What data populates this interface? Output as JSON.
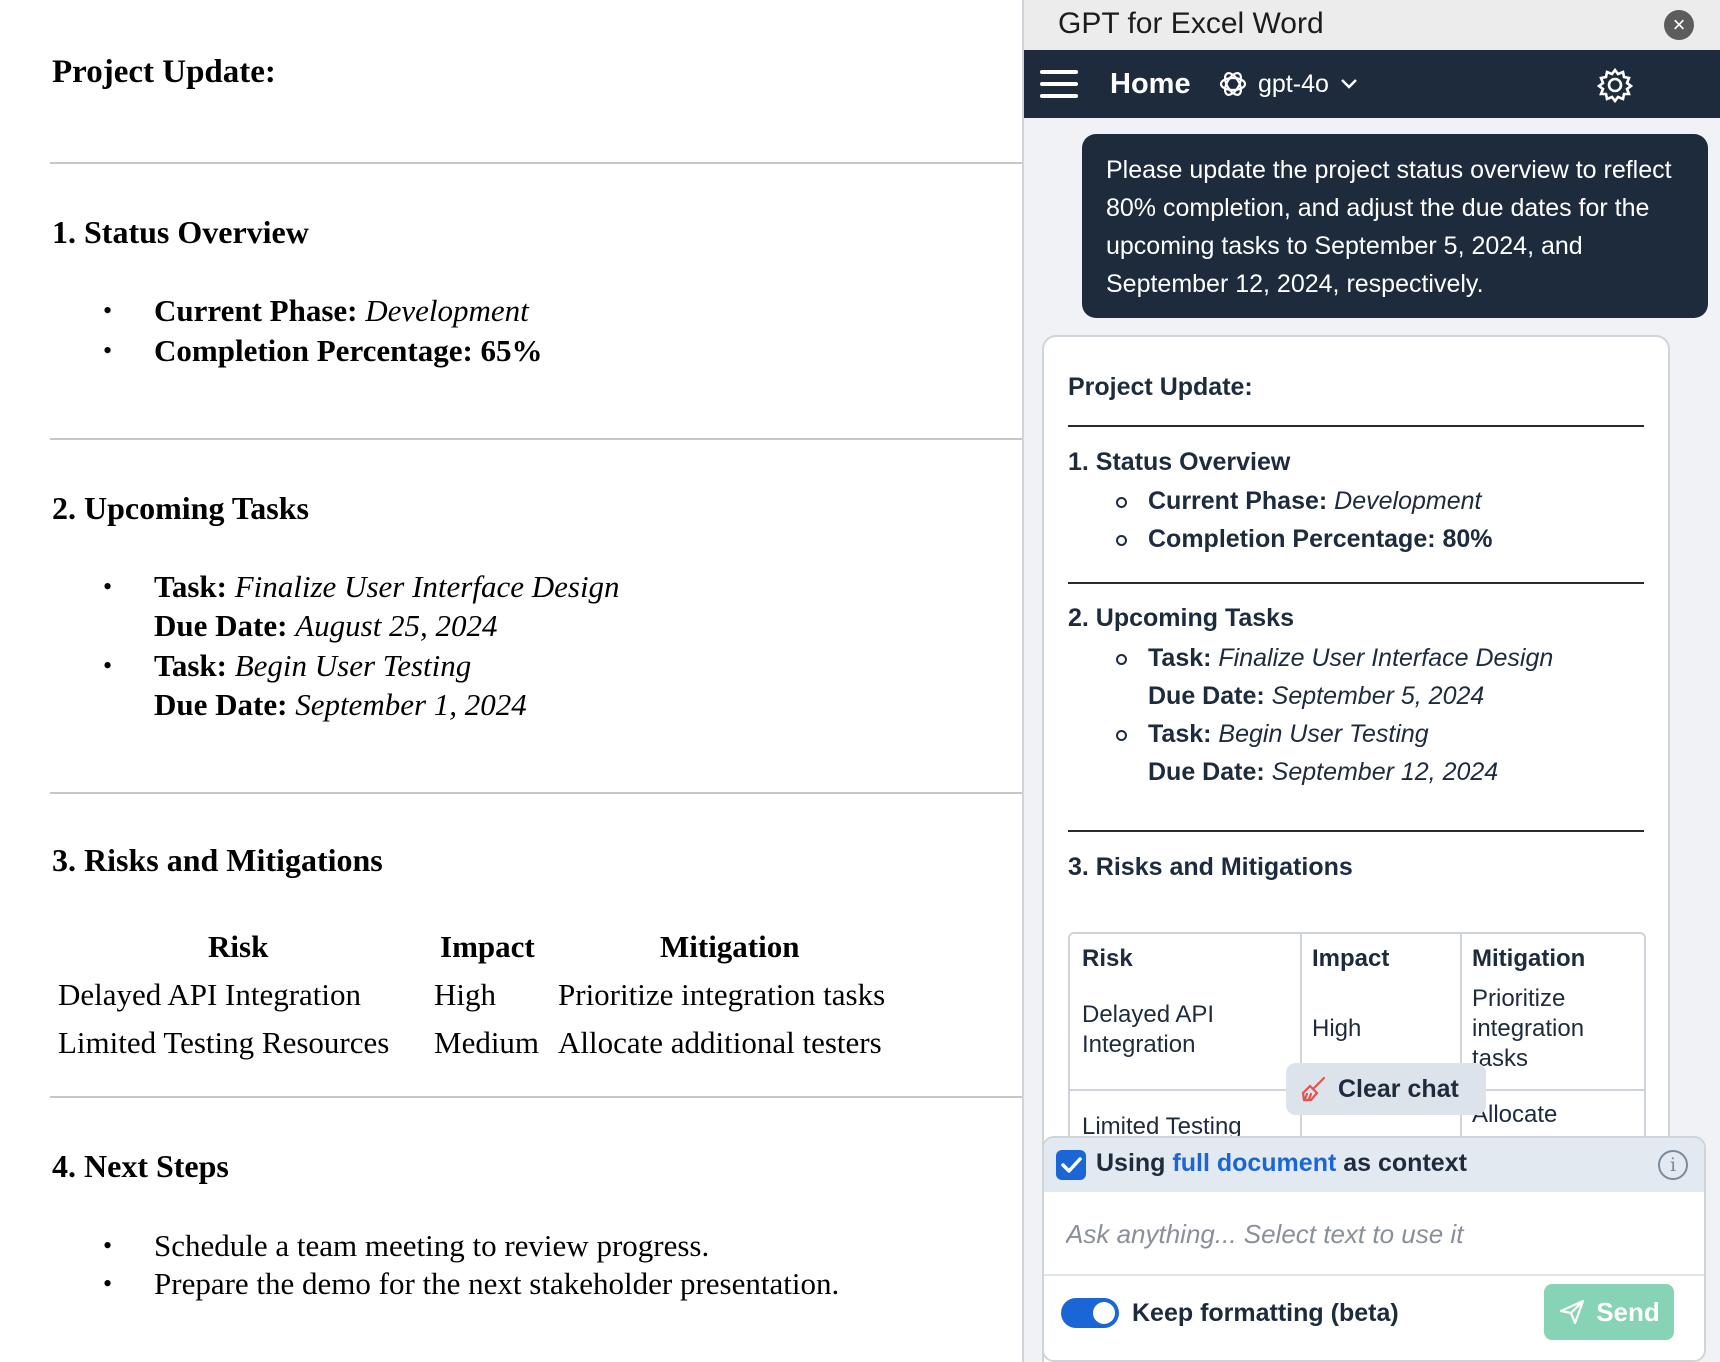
{
  "document": {
    "title": "Project Update:",
    "section1": {
      "heading": "1. Status Overview",
      "phase_label": "Current Phase:",
      "phase_value": "Development",
      "completion": "Completion Percentage: 65%"
    },
    "section2": {
      "heading": "2. Upcoming Tasks",
      "tasks": [
        {
          "task_label": "Task:",
          "task": "Finalize User Interface Design",
          "due_label": "Due Date:",
          "due": "August 25, 2024"
        },
        {
          "task_label": "Task:",
          "task": "Begin User Testing",
          "due_label": "Due Date:",
          "due": "September 1, 2024"
        }
      ]
    },
    "section3": {
      "heading": "3. Risks and Mitigations",
      "columns": [
        "Risk",
        "Impact",
        "Mitigation"
      ],
      "rows": [
        [
          "Delayed API Integration",
          "High",
          "Prioritize integration tasks"
        ],
        [
          "Limited Testing Resources",
          "Medium",
          "Allocate additional testers"
        ]
      ]
    },
    "section4": {
      "heading": "4. Next Steps",
      "items": [
        "Schedule a team meeting to review progress.",
        "Prepare the demo for the next stakeholder presentation."
      ]
    }
  },
  "pane": {
    "window_title": "GPT for Excel Word",
    "nav": {
      "home_label": "Home",
      "model_label": "gpt-4o"
    },
    "user_message": "Please update the project status overview to reflect 80% completion, and adjust the due dates for the upcoming tasks to September 5, 2024, and September 12, 2024, respectively.",
    "response": {
      "title": "Project Update:",
      "section1": {
        "heading": "1. Status Overview",
        "phase_label": "Current Phase:",
        "phase_value": "Development",
        "completion": "Completion Percentage: 80%"
      },
      "section2": {
        "heading": "2. Upcoming Tasks",
        "tasks": [
          {
            "task_label": "Task:",
            "task": "Finalize User Interface Design",
            "due_label": "Due Date:",
            "due": "September 5, 2024"
          },
          {
            "task_label": "Task:",
            "task": "Begin User Testing",
            "due_label": "Due Date:",
            "due": "September 12, 2024"
          }
        ]
      },
      "section3": {
        "heading": "3. Risks and Mitigations",
        "columns": [
          "Risk",
          "Impact",
          "Mitigation"
        ],
        "row1": {
          "risk_l1": "Delayed API",
          "risk_l2": "Integration",
          "impact": "High",
          "mit_l1": "Prioritize",
          "mit_l2": "integration",
          "mit_l3": "tasks"
        },
        "row2": {
          "risk": "Limited Testing",
          "mit": "Allocate"
        }
      }
    },
    "clear_chat_label": "Clear chat",
    "context": {
      "prefix": "Using ",
      "link": "full document",
      "suffix": " as context",
      "checked": true
    },
    "input_placeholder": "Ask anything... Select text to use it",
    "keep_formatting_label": "Keep formatting (beta)",
    "send_label": "Send",
    "colors": {
      "navy": "#1d2b3d",
      "accent": "#1a66d6",
      "send": "#86d3b5",
      "highlight": "#e5534b"
    }
  }
}
